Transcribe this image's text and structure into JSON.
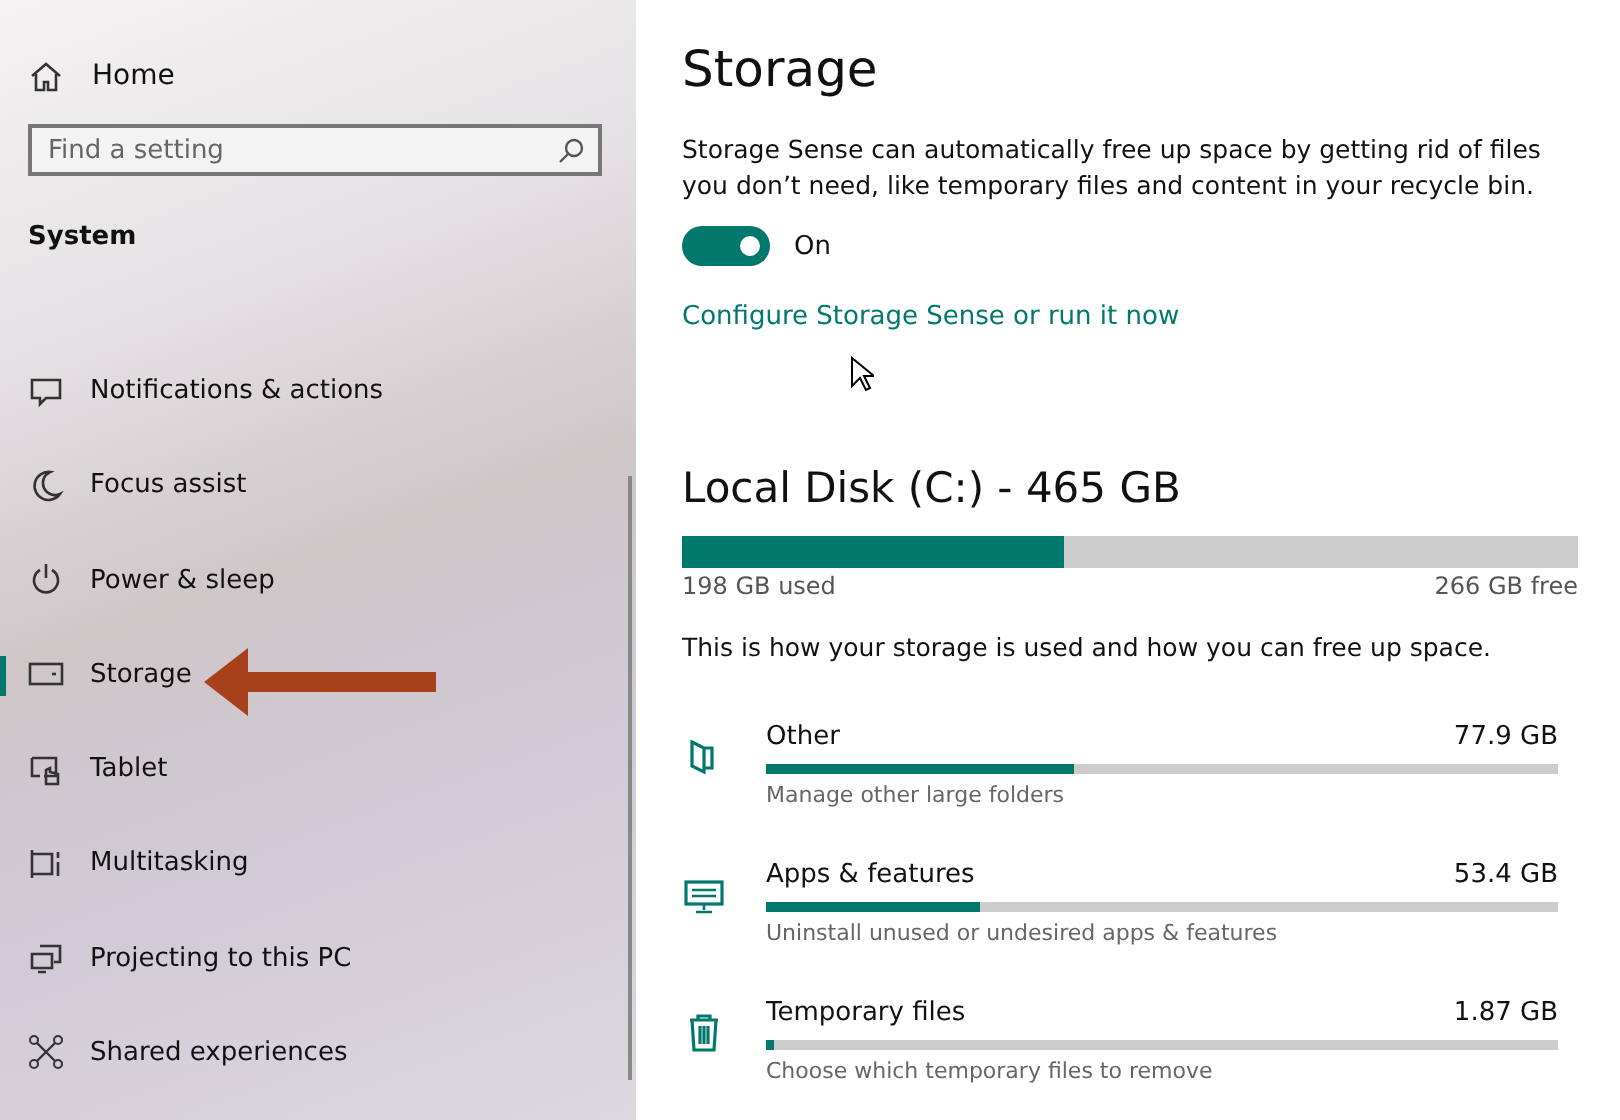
{
  "sidebar": {
    "home": "Home",
    "search": {
      "placeholder": "Find a setting"
    },
    "section": "System",
    "items": [
      {
        "label": "Notifications & actions",
        "selected": false
      },
      {
        "label": "Focus assist",
        "selected": false
      },
      {
        "label": "Power & sleep",
        "selected": false
      },
      {
        "label": "Storage",
        "selected": true
      },
      {
        "label": "Tablet",
        "selected": false
      },
      {
        "label": "Multitasking",
        "selected": false
      },
      {
        "label": "Projecting to this PC",
        "selected": false
      },
      {
        "label": "Shared experiences",
        "selected": false
      }
    ]
  },
  "main": {
    "title": "Storage",
    "description": "Storage Sense can automatically free up space by getting rid of files you don’t need, like temporary files and content in your recycle bin.",
    "toggle": {
      "on": true,
      "label": "On"
    },
    "link": "Configure Storage Sense or run it now",
    "disk": {
      "title": "Local Disk (C:) - 465 GB",
      "level": 0.426,
      "used": "198 GB used",
      "free": "266 GB free"
    },
    "summary": "This is how your storage is used and how you can free up space.",
    "categories": [
      {
        "name": "Other",
        "size": "77.9 GB",
        "level": 0.39,
        "hint": "Manage other large folders"
      },
      {
        "name": "Apps & features",
        "size": "53.4 GB",
        "level": 0.27,
        "hint": "Uninstall unused or undesired apps & features"
      },
      {
        "name": "Temporary files",
        "size": "1.87 GB",
        "level": 0.01,
        "hint": "Choose which temporary files to remove"
      }
    ]
  }
}
